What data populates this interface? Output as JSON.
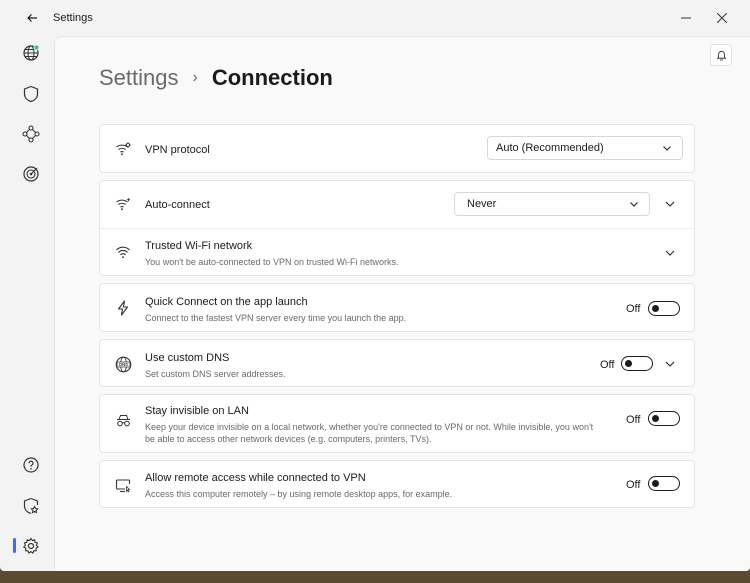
{
  "window": {
    "title": "Settings"
  },
  "breadcrumb": {
    "parent": "Settings",
    "separator": "›",
    "current": "Connection"
  },
  "sidebar": {
    "items": [
      {
        "name": "globe",
        "icon": "globe-icon"
      },
      {
        "name": "shield",
        "icon": "shield-icon"
      },
      {
        "name": "meshnet",
        "icon": "meshnet-icon"
      },
      {
        "name": "threat-target",
        "icon": "target-icon"
      },
      {
        "name": "help",
        "icon": "help-icon"
      },
      {
        "name": "favorites",
        "icon": "shield-star-icon"
      },
      {
        "name": "settings",
        "icon": "gear-icon",
        "active": true
      }
    ],
    "accent": "#3b6ff0",
    "status_dot": "#2ecc71"
  },
  "settings": {
    "vpn_protocol": {
      "title": "VPN protocol",
      "value": "Auto (Recommended)"
    },
    "auto_connect": {
      "title": "Auto-connect",
      "value": "Never"
    },
    "trusted_wifi": {
      "title": "Trusted Wi-Fi network",
      "subtitle": "You won't be auto-connected to VPN on trusted Wi-Fi networks."
    },
    "quick_connect": {
      "title": "Quick Connect on the app launch",
      "subtitle": "Connect to the fastest VPN server every time you launch the app.",
      "state": "Off"
    },
    "custom_dns": {
      "title": "Use custom DNS",
      "subtitle": "Set custom DNS server addresses.",
      "state": "Off"
    },
    "invisible_lan": {
      "title": "Stay invisible on LAN",
      "subtitle": "Keep your device invisible on a local network, whether you're connected to VPN or not. While invisible, you won't be able to access other network devices (e.g. computers, printers, TVs).",
      "state": "Off"
    },
    "remote_access": {
      "title": "Allow remote access while connected to VPN",
      "subtitle": "Access this computer remotely – by using remote desktop apps, for example.",
      "state": "Off"
    }
  }
}
